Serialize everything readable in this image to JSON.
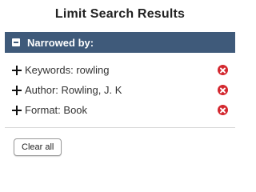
{
  "panel": {
    "title": "Limit Search Results"
  },
  "narrowed": {
    "header_label": "Narrowed by:",
    "icon": "collapse-minus-icon",
    "header_color": "#3f5a7a"
  },
  "filters": [
    {
      "label": "Keywords: rowling",
      "expand_icon": "plus-icon",
      "remove_icon": "remove-circle-x-icon"
    },
    {
      "label": "Author: Rowling, J. K",
      "expand_icon": "plus-icon",
      "remove_icon": "remove-circle-x-icon"
    },
    {
      "label": "Format: Book",
      "expand_icon": "plus-icon",
      "remove_icon": "remove-circle-x-icon"
    }
  ],
  "actions": {
    "clear_all_label": "Clear all"
  },
  "colors": {
    "remove_icon": "#d3282f",
    "header_bg": "#3f5a7a"
  }
}
